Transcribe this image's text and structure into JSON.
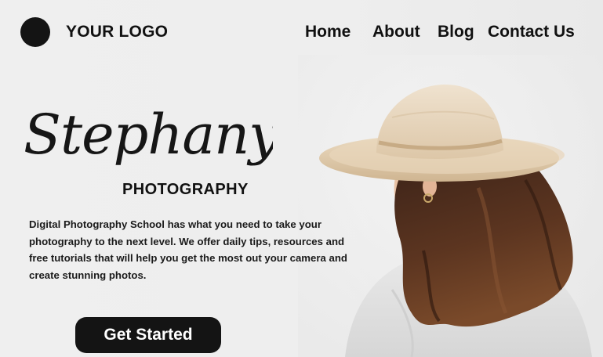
{
  "header": {
    "logo_text": "YOUR LOGO",
    "nav": [
      "Home",
      "About",
      "Blog",
      "Contact Us"
    ]
  },
  "hero": {
    "script_title": "Stephany",
    "subtitle": "PHOTOGRAPHY",
    "description": "Digital Photography School has what you need to take your photography to the next level. We offer daily tips, resources and free tutorials that will help you get the most out your camera and create stunning photos.",
    "cta_label": "Get Started"
  },
  "colors": {
    "background": "#efefef",
    "text": "#111111",
    "button": "#141414",
    "button_text": "#ffffff"
  }
}
